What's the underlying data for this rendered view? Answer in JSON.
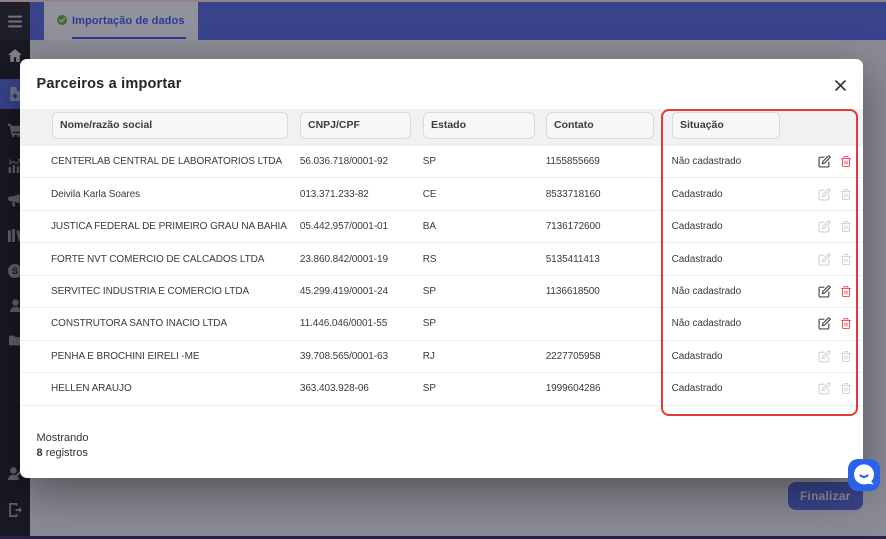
{
  "app": {
    "topbar": {
      "tab": {
        "label": "Importação de dados",
        "status_icon": "check-circle",
        "status_color": "#73b243"
      },
      "color": "#5e72e4"
    },
    "sidebar": {
      "items": [
        {
          "icon": "menu-icon"
        },
        {
          "icon": "home-icon"
        },
        {
          "icon": "file-plus-icon",
          "selected": true
        },
        {
          "icon": "cart-icon"
        },
        {
          "icon": "chart-dollar-icon"
        },
        {
          "icon": "megaphone-icon"
        },
        {
          "icon": "books-icon"
        },
        {
          "icon": "dollar-circle-icon"
        },
        {
          "icon": "person-icon"
        },
        {
          "icon": "folder-icon"
        },
        {
          "icon": "person-edit-icon"
        },
        {
          "icon": "logout-icon"
        }
      ]
    },
    "footer_button": {
      "label": "Finalizar"
    }
  },
  "modal": {
    "title": "Parceiros a importar",
    "close_icon": "x",
    "table": {
      "columns": {
        "nome": "Nome/razão social",
        "cnpj": "CNPJ/CPF",
        "estado": "Estado",
        "contato": "Contato",
        "situacao": "Situação"
      },
      "rows": [
        {
          "nome": "CENTERLAB CENTRAL DE LABORATORIOS LTDA",
          "cnpj": "56.036.718/0001-92",
          "estado": "SP",
          "contato": "1155855669",
          "situacao": "Não cadastrado",
          "actions_enabled": true
        },
        {
          "nome": "Deivila Karla Soares",
          "cnpj": "013.371.233-82",
          "estado": "CE",
          "contato": "8533718160",
          "situacao": "Cadastrado",
          "actions_enabled": false
        },
        {
          "nome": "JUSTICA FEDERAL DE PRIMEIRO GRAU NA BAHIA",
          "cnpj": "05.442.957/0001-01",
          "estado": "BA",
          "contato": "7136172600",
          "situacao": "Cadastrado",
          "actions_enabled": false
        },
        {
          "nome": "FORTE NVT COMERCIO DE CALCADOS LTDA",
          "cnpj": "23.860.842/0001-19",
          "estado": "RS",
          "contato": "5135411413",
          "situacao": "Cadastrado",
          "actions_enabled": false
        },
        {
          "nome": "SERVITEC INDUSTRIA E COMERCIO LTDA",
          "cnpj": "45.299.419/0001-24",
          "estado": "SP",
          "contato": "1136618500",
          "situacao": "Não cadastrado",
          "actions_enabled": true
        },
        {
          "nome": "CONSTRUTORA SANTO INACIO LTDA",
          "cnpj": "11.446.046/0001-55",
          "estado": "SP",
          "contato": "",
          "situacao": "Não cadastrado",
          "actions_enabled": true
        },
        {
          "nome": "PENHA E BROCHINI EIRELI -ME",
          "cnpj": "39.708.565/0001-63",
          "estado": "RJ",
          "contato": "2227705958",
          "situacao": "Cadastrado",
          "actions_enabled": false
        },
        {
          "nome": "HELLEN ARAUJO",
          "cnpj": "363.403.928-06",
          "estado": "SP",
          "contato": "1999604286",
          "situacao": "Cadastrado",
          "actions_enabled": false
        }
      ]
    },
    "footer": {
      "showing_label": "Mostrando",
      "count": "8",
      "count_label": "registros"
    },
    "annotation": {
      "shape": "red-rounded-rectangle",
      "color": "#e03b3b",
      "highlights": "Situação column"
    }
  },
  "chat_widget": {
    "icon": "chat-bubble-icon",
    "color": "#2a63ea"
  }
}
